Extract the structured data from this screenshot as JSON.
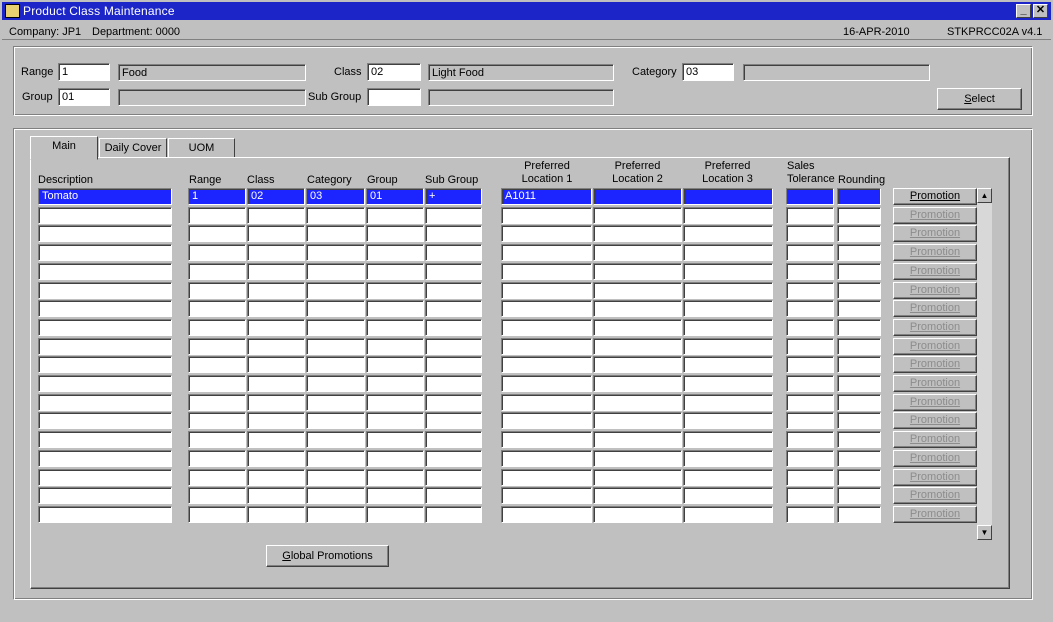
{
  "window": {
    "title": "Product Class Maintenance",
    "minimize_label": "_",
    "close_label": "✕"
  },
  "status": {
    "company": "Company: JP1",
    "department": "Department: 0000",
    "date": "16-APR-2010",
    "program": "STKPRCC02A  v4.1"
  },
  "selection": {
    "range_label": "Range",
    "range_value": "1",
    "range_desc": "Food",
    "class_label": "Class",
    "class_value": "02",
    "class_desc": "Light Food",
    "category_label": "Category",
    "category_value": "03",
    "category_desc": "",
    "group_label": "Group",
    "group_value": "01",
    "group_desc": "",
    "subgroup_label": "Sub Group",
    "subgroup_value": "",
    "subgroup_desc": "",
    "select_button": "Select"
  },
  "tabs": [
    {
      "label": "Main",
      "active": true
    },
    {
      "label": "Daily Cover",
      "active": false
    },
    {
      "label": "UOM",
      "active": false
    }
  ],
  "grid": {
    "headers": {
      "description": "Description",
      "range": "Range",
      "class": "Class",
      "category": "Category",
      "group": "Group",
      "subgroup": "Sub Group",
      "loc1_l1": "Preferred",
      "loc1_l2": "Location 1",
      "loc2_l1": "Preferred",
      "loc2_l2": "Location 2",
      "loc3_l1": "Preferred",
      "loc3_l2": "Location 3",
      "tol_l1": "Sales",
      "tol_l2": "Tolerance",
      "rounding": "Rounding"
    },
    "rows": [
      {
        "description": "Tomato",
        "range": "1",
        "class": "02",
        "category": "03",
        "group": "01",
        "subgroup": "+",
        "loc1": "A1011",
        "loc2": "",
        "loc3": "",
        "tolerance": "",
        "rounding": ""
      },
      {
        "description": "",
        "range": "",
        "class": "",
        "category": "",
        "group": "",
        "subgroup": "",
        "loc1": "",
        "loc2": "",
        "loc3": "",
        "tolerance": "",
        "rounding": ""
      },
      {
        "description": "",
        "range": "",
        "class": "",
        "category": "",
        "group": "",
        "subgroup": "",
        "loc1": "",
        "loc2": "",
        "loc3": "",
        "tolerance": "",
        "rounding": ""
      },
      {
        "description": "",
        "range": "",
        "class": "",
        "category": "",
        "group": "",
        "subgroup": "",
        "loc1": "",
        "loc2": "",
        "loc3": "",
        "tolerance": "",
        "rounding": ""
      },
      {
        "description": "",
        "range": "",
        "class": "",
        "category": "",
        "group": "",
        "subgroup": "",
        "loc1": "",
        "loc2": "",
        "loc3": "",
        "tolerance": "",
        "rounding": ""
      },
      {
        "description": "",
        "range": "",
        "class": "",
        "category": "",
        "group": "",
        "subgroup": "",
        "loc1": "",
        "loc2": "",
        "loc3": "",
        "tolerance": "",
        "rounding": ""
      },
      {
        "description": "",
        "range": "",
        "class": "",
        "category": "",
        "group": "",
        "subgroup": "",
        "loc1": "",
        "loc2": "",
        "loc3": "",
        "tolerance": "",
        "rounding": ""
      },
      {
        "description": "",
        "range": "",
        "class": "",
        "category": "",
        "group": "",
        "subgroup": "",
        "loc1": "",
        "loc2": "",
        "loc3": "",
        "tolerance": "",
        "rounding": ""
      },
      {
        "description": "",
        "range": "",
        "class": "",
        "category": "",
        "group": "",
        "subgroup": "",
        "loc1": "",
        "loc2": "",
        "loc3": "",
        "tolerance": "",
        "rounding": ""
      },
      {
        "description": "",
        "range": "",
        "class": "",
        "category": "",
        "group": "",
        "subgroup": "",
        "loc1": "",
        "loc2": "",
        "loc3": "",
        "tolerance": "",
        "rounding": ""
      },
      {
        "description": "",
        "range": "",
        "class": "",
        "category": "",
        "group": "",
        "subgroup": "",
        "loc1": "",
        "loc2": "",
        "loc3": "",
        "tolerance": "",
        "rounding": ""
      },
      {
        "description": "",
        "range": "",
        "class": "",
        "category": "",
        "group": "",
        "subgroup": "",
        "loc1": "",
        "loc2": "",
        "loc3": "",
        "tolerance": "",
        "rounding": ""
      },
      {
        "description": "",
        "range": "",
        "class": "",
        "category": "",
        "group": "",
        "subgroup": "",
        "loc1": "",
        "loc2": "",
        "loc3": "",
        "tolerance": "",
        "rounding": ""
      },
      {
        "description": "",
        "range": "",
        "class": "",
        "category": "",
        "group": "",
        "subgroup": "",
        "loc1": "",
        "loc2": "",
        "loc3": "",
        "tolerance": "",
        "rounding": ""
      },
      {
        "description": "",
        "range": "",
        "class": "",
        "category": "",
        "group": "",
        "subgroup": "",
        "loc1": "",
        "loc2": "",
        "loc3": "",
        "tolerance": "",
        "rounding": ""
      },
      {
        "description": "",
        "range": "",
        "class": "",
        "category": "",
        "group": "",
        "subgroup": "",
        "loc1": "",
        "loc2": "",
        "loc3": "",
        "tolerance": "",
        "rounding": ""
      },
      {
        "description": "",
        "range": "",
        "class": "",
        "category": "",
        "group": "",
        "subgroup": "",
        "loc1": "",
        "loc2": "",
        "loc3": "",
        "tolerance": "",
        "rounding": ""
      },
      {
        "description": "",
        "range": "",
        "class": "",
        "category": "",
        "group": "",
        "subgroup": "",
        "loc1": "",
        "loc2": "",
        "loc3": "",
        "tolerance": "",
        "rounding": ""
      }
    ],
    "promotion_label": "Promotion",
    "scroll_up_icon": "▲",
    "scroll_down_icon": "▼"
  },
  "global_promotions_button": "Global Promotions",
  "colors": {
    "titlebar": "#1c25c8",
    "selected_row": "#1c25ff",
    "face": "#c0c0c0"
  }
}
